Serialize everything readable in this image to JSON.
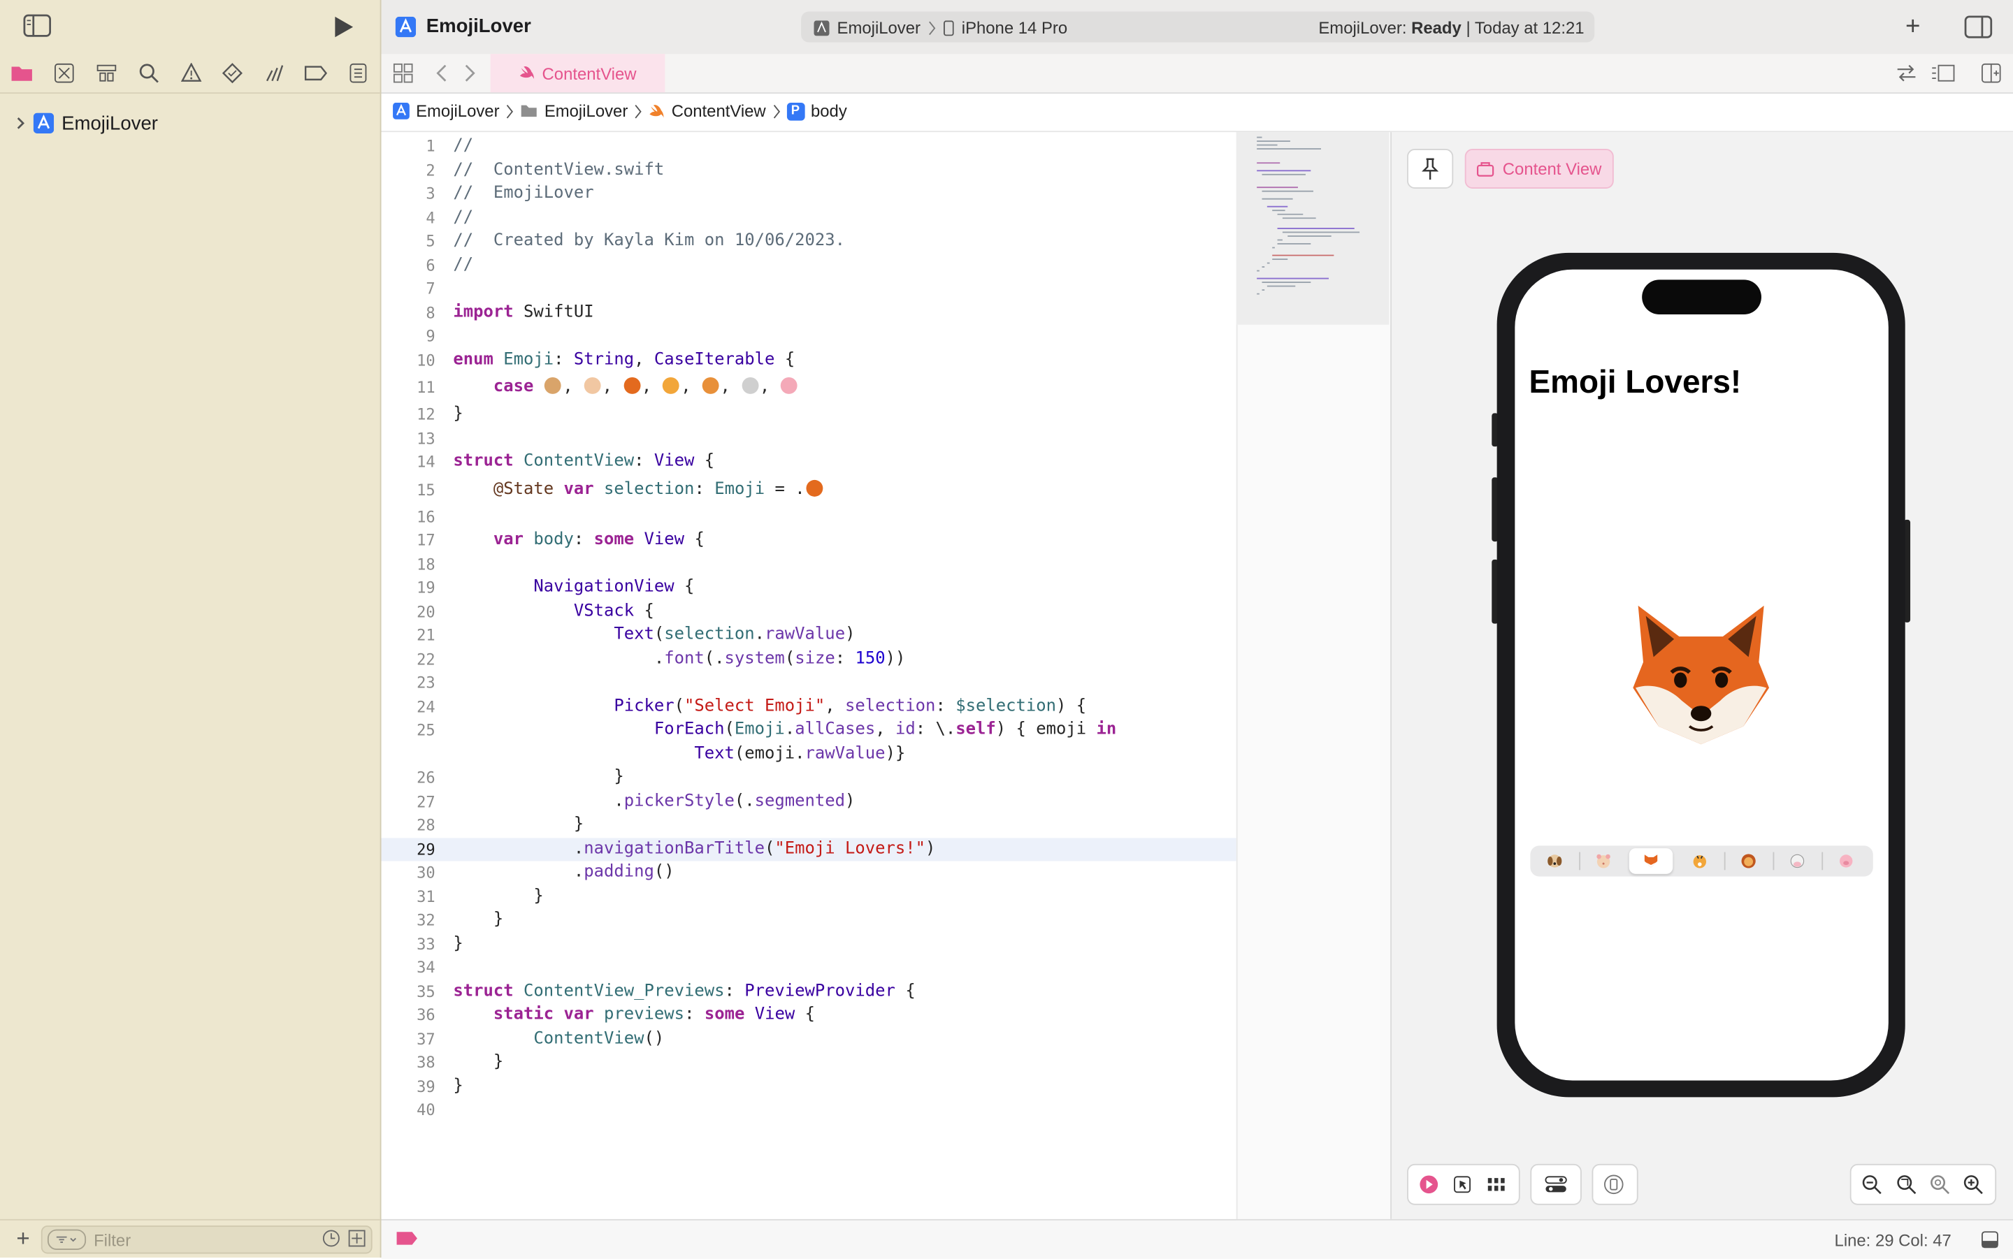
{
  "sidebar": {
    "project_name": "EmojiLover",
    "filter_placeholder": "Filter"
  },
  "toolbar": {
    "title": "EmojiLover",
    "scheme": "EmojiLover",
    "device": "iPhone 14 Pro",
    "status_app": "EmojiLover:",
    "status_state": "Ready",
    "status_time": "| Today at 12:21"
  },
  "tab": {
    "label": "ContentView"
  },
  "breadcrumb": {
    "project": "EmojiLover",
    "folder": "EmojiLover",
    "file": "ContentView",
    "symbol_badge": "P",
    "symbol": "body"
  },
  "editor": {
    "current_line": 29
  },
  "preview": {
    "chip_label": "Content View",
    "nav_title": "Emoji Lovers!",
    "selected_segment": 2,
    "segments": [
      "dog",
      "hamster",
      "fox",
      "tiger",
      "lion",
      "cow",
      "pig"
    ]
  },
  "statusbar": {
    "position": "Line: 29  Col: 47"
  },
  "colors": {
    "accent": "#e5548d",
    "sidebar_bg": "#ede7cf",
    "keyword": "#9b2393",
    "string": "#c41a16",
    "type": "#3900a0"
  }
}
